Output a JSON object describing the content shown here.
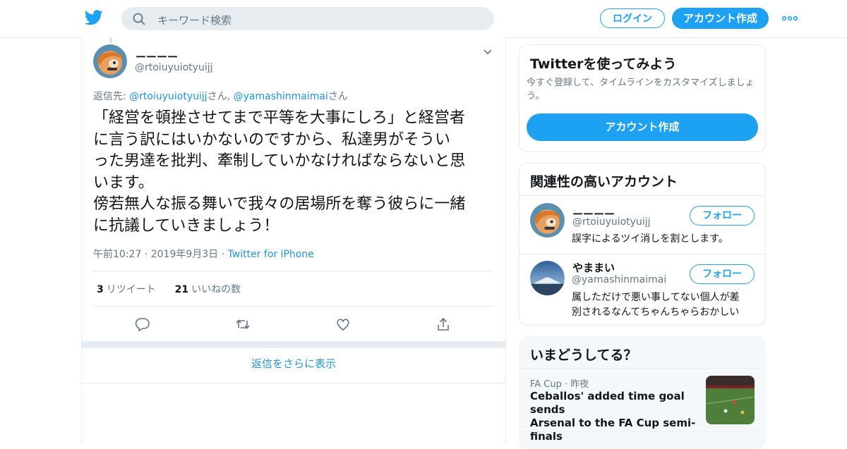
{
  "topbar": {
    "search_placeholder": "キーワード検索",
    "login_label": "ログイン",
    "signup_label": "アカウント作成"
  },
  "tweet": {
    "display_name": "ーーーー",
    "handle": "@rtoiuyuiotyuijj",
    "reply_prefix": "返信先: ",
    "reply_user1": "@rtoiuyuiotyuijj",
    "reply_san1": "さん, ",
    "reply_user2": "@yamashinmaimai",
    "reply_san2": "さん",
    "text": "「経営を頓挫させてまで平等を大事にしろ」と経営者\nに言う訳にはいかないのですから、私達男がそうい\nった男達を批判、牽制していかなければならないと思\nいます。\n傍若無人な振る舞いで我々の居場所を奪う彼らに一緒\nに抗議していきましょう！",
    "time": "午前10:27",
    "date": "2019年9月3日",
    "source": "Twitter for iPhone",
    "retweet_count": "3",
    "retweet_label": "リツイート",
    "like_count": "21",
    "like_label": "いいねの数",
    "more_replies": "返信をさらに表示"
  },
  "signup_card": {
    "title": "Twitterを使ってみよう",
    "subtitle": "今すぐ登録して、タイムラインをカスタマイズしましょ\nう。",
    "button": "アカウント作成"
  },
  "related": {
    "title": "関連性の高いアカウント",
    "follow_label": "フォロー",
    "accounts": [
      {
        "name": "ーーーー",
        "handle": "@rtoiuyuiotyuijj",
        "bio": "誤字によるツイ消しを割とします。"
      },
      {
        "name": "やままい",
        "handle": "@yamashinmaimai",
        "bio": "属しただけで悪い事してない個人が差\n別されるなんてちゃんちゃらおかしい"
      }
    ]
  },
  "trends": {
    "title": "いまどうしてる？",
    "items": [
      {
        "category": "FA Cup",
        "time": "昨夜",
        "headline": "Ceballos' added time goal sends\nArsenal to the FA Cup semi-finals"
      }
    ]
  },
  "colors": {
    "accent": "#1da1f2",
    "link": "#1b95e0",
    "muted": "#657786",
    "border": "#e6ecf0"
  }
}
